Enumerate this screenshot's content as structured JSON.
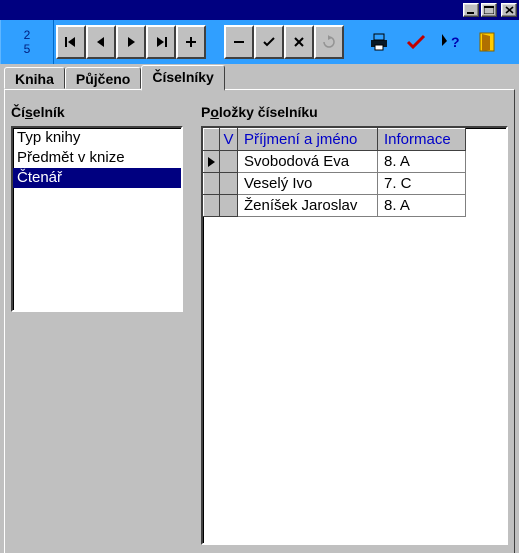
{
  "titlebar": {
    "buttons": [
      "minimize",
      "maximize",
      "close"
    ]
  },
  "toolbar": {
    "counter_top": "2",
    "counter_bottom": "5",
    "nav": [
      "first",
      "prev",
      "next",
      "last",
      "add",
      "remove",
      "commit",
      "cancel",
      "refresh"
    ],
    "actions": [
      "print",
      "check",
      "help",
      "exit"
    ]
  },
  "tabs": [
    {
      "label": "Kniha",
      "active": false
    },
    {
      "label": "Půjčeno",
      "active": false
    },
    {
      "label": "Číselníky",
      "active": true
    }
  ],
  "left": {
    "heading_pre": "Čí",
    "heading_u": "s",
    "heading_post": "elník",
    "items": [
      {
        "label": "Typ knihy",
        "selected": false
      },
      {
        "label": "Předmět v knize",
        "selected": false
      },
      {
        "label": "Čtenář",
        "selected": true
      }
    ]
  },
  "right": {
    "heading_pre": "P",
    "heading_u": "o",
    "heading_post": "ložky číselníku",
    "columns": {
      "sel": "V",
      "name": "Příjmení a jméno",
      "info": "Informace"
    },
    "rows": [
      {
        "current": true,
        "name": "Svobodová Eva",
        "info": "8. A"
      },
      {
        "current": false,
        "name": "Veselý Ivo",
        "info": "7. C"
      },
      {
        "current": false,
        "name": "Ženíšek Jaroslav",
        "info": "8. A"
      }
    ]
  }
}
